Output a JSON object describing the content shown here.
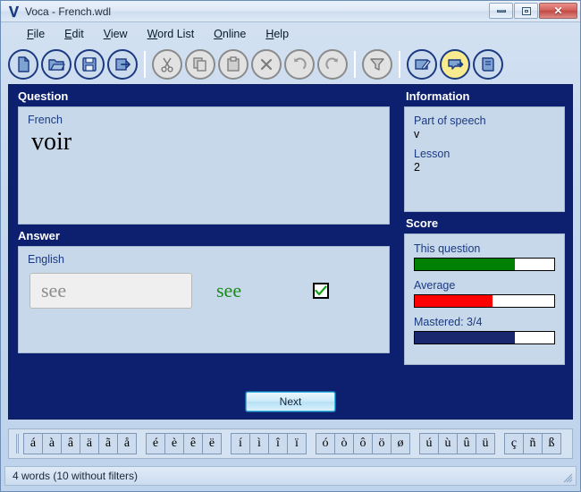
{
  "window": {
    "title": "Voca - French.wdl",
    "logo_icon": "voca-logo-icon",
    "minimize_label": "Minimize",
    "restore_label": "Restore",
    "close_label": "Close",
    "close_glyph": "✕"
  },
  "menu": {
    "items": [
      {
        "name": "file",
        "mnemonic": "F",
        "rest": "ile"
      },
      {
        "name": "edit",
        "mnemonic": "E",
        "rest": "dit"
      },
      {
        "name": "view",
        "mnemonic": "V",
        "rest": "iew"
      },
      {
        "name": "word-list",
        "mnemonic": "W",
        "rest": "ord List"
      },
      {
        "name": "online",
        "mnemonic": "O",
        "rest": "nline"
      },
      {
        "name": "help",
        "mnemonic": "H",
        "rest": "elp"
      }
    ]
  },
  "toolbar": {
    "buttons": [
      {
        "name": "new-icon",
        "state": "blue"
      },
      {
        "name": "open-icon",
        "state": "blue"
      },
      {
        "name": "save-icon",
        "state": "blue"
      },
      {
        "name": "export-icon",
        "state": "blue"
      },
      {
        "name": "separator",
        "state": "sep"
      },
      {
        "name": "cut-icon",
        "state": "gray"
      },
      {
        "name": "copy-icon",
        "state": "gray"
      },
      {
        "name": "paste-icon",
        "state": "gray"
      },
      {
        "name": "delete-icon",
        "state": "gray"
      },
      {
        "name": "undo-icon",
        "state": "gray"
      },
      {
        "name": "redo-icon",
        "state": "gray"
      },
      {
        "name": "separator",
        "state": "sep"
      },
      {
        "name": "filter-icon",
        "state": "gray"
      },
      {
        "name": "separator",
        "state": "sep"
      },
      {
        "name": "edit-list-icon",
        "state": "blue"
      },
      {
        "name": "practice-icon",
        "state": "hl"
      },
      {
        "name": "lessons-icon",
        "state": "blue"
      }
    ]
  },
  "question": {
    "section_title": "Question",
    "language_label": "French",
    "word": "voir"
  },
  "answer": {
    "section_title": "Answer",
    "language_label": "English",
    "input_value": "see",
    "input_placeholder": "see",
    "correct_answer": "see",
    "correct_icon": "checkmark-icon",
    "checked": true
  },
  "information": {
    "section_title": "Information",
    "fields": [
      {
        "label": "Part of speech",
        "value": "v"
      },
      {
        "label": "Lesson",
        "value": "2"
      }
    ]
  },
  "score": {
    "section_title": "Score",
    "bars": [
      {
        "label": "This question",
        "percent": 72,
        "color": "#008000"
      },
      {
        "label": "Average",
        "percent": 56,
        "color": "#ff0000"
      },
      {
        "label": "Mastered: 3/4",
        "percent": 72,
        "color": "#18276e"
      }
    ]
  },
  "actions": {
    "next_label": "Next"
  },
  "accent_keys": {
    "groups": [
      [
        "á",
        "à",
        "â",
        "ä",
        "ã",
        "å"
      ],
      [
        "é",
        "è",
        "ê",
        "ë"
      ],
      [
        "í",
        "ì",
        "î",
        "ï"
      ],
      [
        "ó",
        "ò",
        "ô",
        "ö",
        "ø"
      ],
      [
        "ú",
        "ù",
        "û",
        "ü"
      ],
      [
        "ç",
        "ñ",
        "ß"
      ]
    ]
  },
  "statusbar": {
    "text": "4 words (10 without filters)"
  },
  "colors": {
    "panel_bg": "#c7d8ea",
    "section_bg": "#0d2070",
    "label_blue": "#1b3a82",
    "correct_green": "#1a8a1a",
    "accent_red": "#ff0000"
  }
}
